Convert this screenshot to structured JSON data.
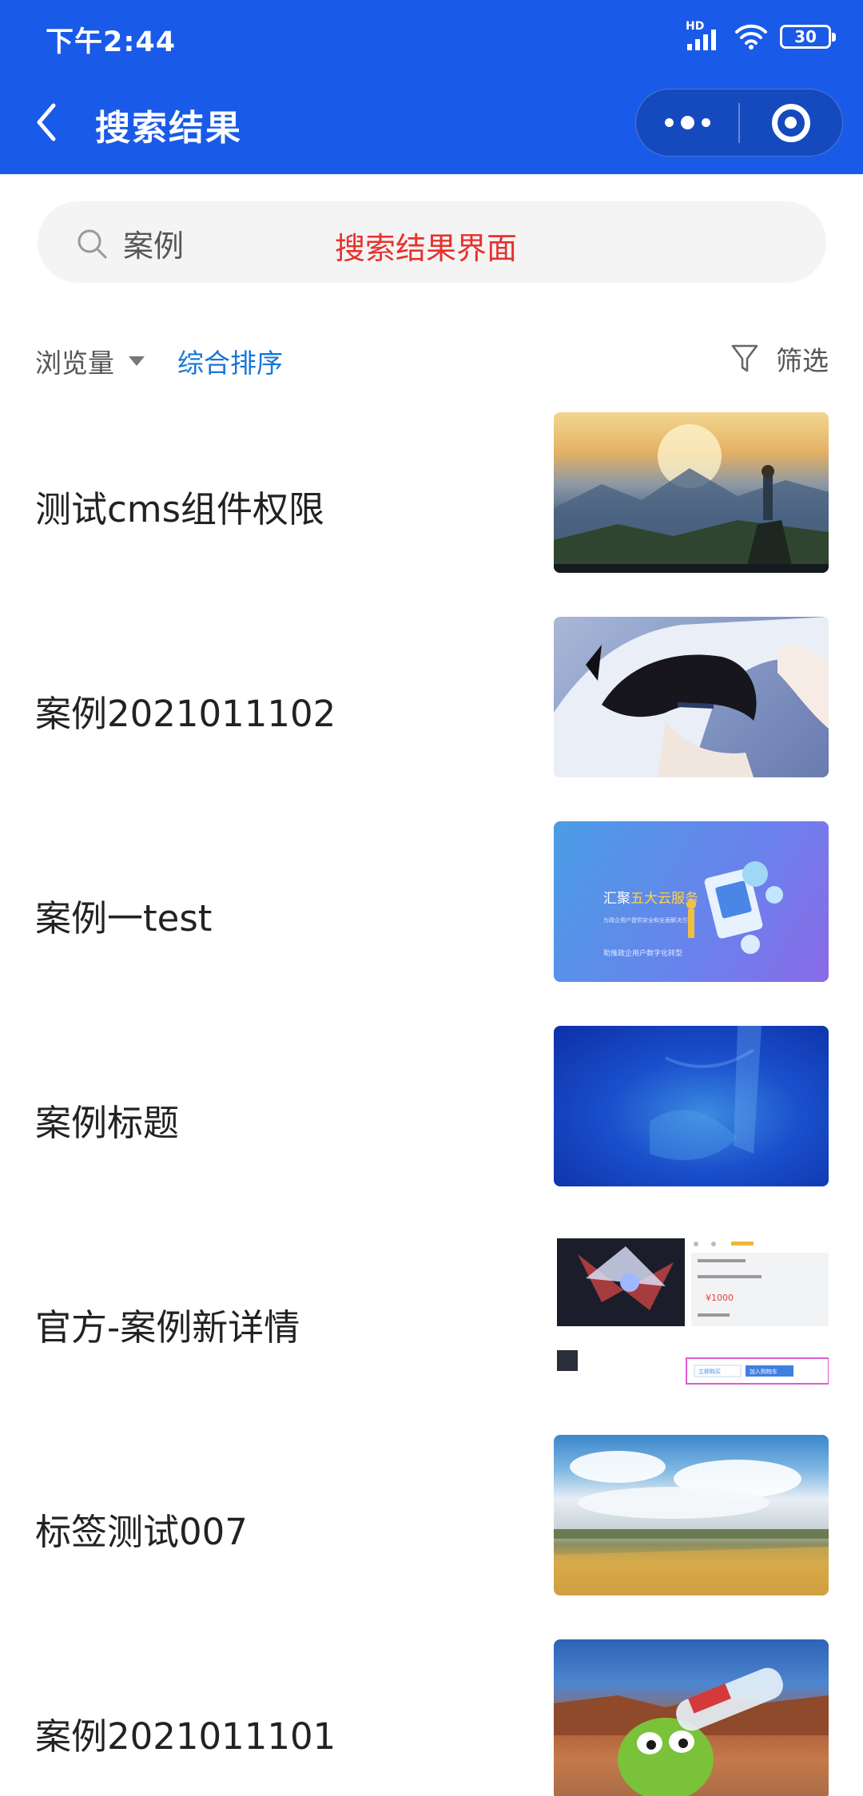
{
  "status_bar": {
    "time": "下午2:44",
    "hd_label": "HD",
    "battery": "30"
  },
  "header": {
    "title": "搜索结果"
  },
  "search": {
    "value": "案例",
    "placeholder": "",
    "annotation": "搜索结果界面"
  },
  "filter_bar": {
    "views_label": "浏览量",
    "default_sort_label": "综合排序",
    "filter_label": "筛选"
  },
  "results": [
    {
      "title": "测试cms组件权限"
    },
    {
      "title": "案例2021011102"
    },
    {
      "title": "案例一test"
    },
    {
      "title": "案例标题"
    },
    {
      "title": "官方-案例新详情"
    },
    {
      "title": "标签测试007"
    },
    {
      "title": "案例2021011101"
    }
  ],
  "thumb_texts": {
    "service_brand": "汇聚",
    "service_highlight": "五大云服务",
    "service_line1": "为政企用户提供安全和全面解决方案",
    "service_line2": "助推政企用户数字化转型",
    "price": "¥1000",
    "btn_consult": "立即购买",
    "btn_cart": "加入购物车"
  },
  "colors": {
    "header_bg": "#1a5ae8",
    "accent_blue": "#1677d8",
    "annotation_red": "#e8312b"
  }
}
